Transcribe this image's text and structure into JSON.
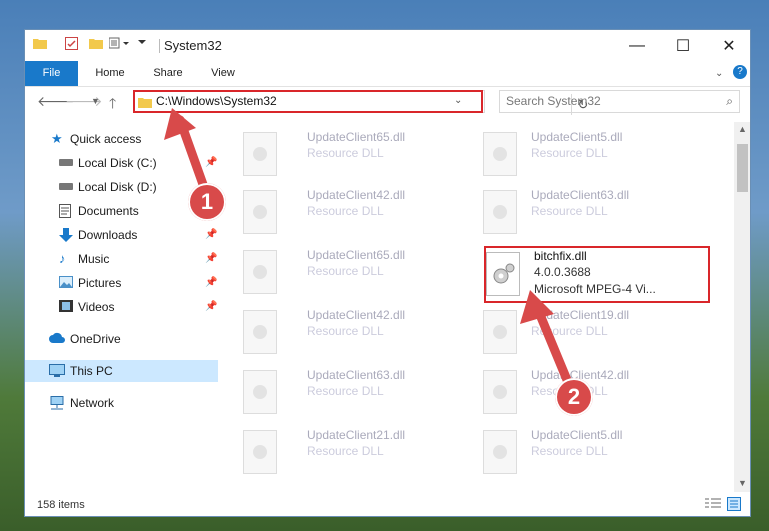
{
  "window": {
    "title": "System32",
    "controls": {
      "minimize": "—",
      "maximize": "☐",
      "close": "✕"
    }
  },
  "ribbon": {
    "tabs": [
      "File",
      "Home",
      "Share",
      "View"
    ]
  },
  "address": {
    "path": "C:\\Windows\\System32",
    "search_placeholder": "Search System32"
  },
  "sidebar": {
    "items": [
      {
        "label": "Quick access",
        "icon": "star-icon"
      },
      {
        "label": "Local Disk (C:)",
        "icon": "drive-icon"
      },
      {
        "label": "Local Disk (D:)",
        "icon": "drive-icon"
      },
      {
        "label": "Documents",
        "icon": "documents-icon"
      },
      {
        "label": "Downloads",
        "icon": "download-icon"
      },
      {
        "label": "Music",
        "icon": "music-icon"
      },
      {
        "label": "Pictures",
        "icon": "pictures-icon"
      },
      {
        "label": "Videos",
        "icon": "videos-icon"
      },
      {
        "label": "OneDrive",
        "icon": "cloud-icon"
      },
      {
        "label": "This PC",
        "icon": "computer-icon"
      },
      {
        "label": "Network",
        "icon": "network-icon"
      }
    ]
  },
  "files": [
    {
      "name": "UpdateClient65.dll",
      "desc": "Resource DLL"
    },
    {
      "name": "UpdateClient5.dll",
      "desc": "Resource DLL"
    },
    {
      "name": "UpdateClient42.dll",
      "desc": "Resource DLL"
    },
    {
      "name": "UpdateClient63.dll",
      "desc": "Resource DLL"
    },
    {
      "name": "UpdateClient65.dll",
      "desc": "Resource DLL"
    },
    {
      "name": "bitchfix.dll",
      "version": "4.0.0.3688",
      "desc": "Microsoft MPEG-4 Vi..."
    },
    {
      "name": "UpdateClient42.dll",
      "desc": "Resource DLL"
    },
    {
      "name": "UpdateClient19.dll",
      "desc": "Resource DLL"
    },
    {
      "name": "UpdateClient63.dll",
      "desc": "Resource DLL"
    },
    {
      "name": "UpdateClient42.dll",
      "desc": "Resource DLL"
    },
    {
      "name": "UpdateClient21.dll",
      "desc": "Resource DLL"
    },
    {
      "name": "UpdateClient5.dll",
      "desc": "Resource DLL"
    }
  ],
  "status": {
    "count": "158 items"
  },
  "markers": [
    "1",
    "2"
  ],
  "colors": {
    "accent": "#1979ca",
    "highlight": "#d9262a",
    "marker": "#d84a4a"
  }
}
